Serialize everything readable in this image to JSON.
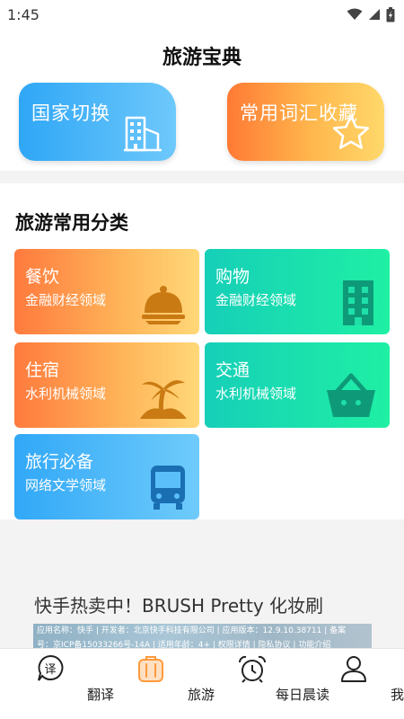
{
  "status_bar": {
    "time": "1:45"
  },
  "header": {
    "title": "旅游宝典",
    "cards": [
      {
        "label": "国家切换",
        "icon": "building-icon"
      },
      {
        "label": "常用词汇收藏",
        "icon": "star-icon"
      }
    ]
  },
  "categories": {
    "title": "旅游常用分类",
    "items": [
      {
        "title": "餐饮",
        "subtitle": "金融财经领域",
        "icon": "food-dome-icon",
        "color": "#ff8a3d"
      },
      {
        "title": "购物",
        "subtitle": "金融财经领域",
        "icon": "office-building-icon",
        "color": "#1ee0a8"
      },
      {
        "title": "住宿",
        "subtitle": "水利机械领域",
        "icon": "palm-island-icon",
        "color": "#ff8a3d"
      },
      {
        "title": "交通",
        "subtitle": "水利机械领域",
        "icon": "basket-icon",
        "color": "#1ee0a8"
      },
      {
        "title": "旅行必备",
        "subtitle": "网络文学领域",
        "icon": "bus-icon",
        "color": "#3aaaf7"
      }
    ]
  },
  "ad": {
    "title": "快手热卖中！BRUSH Pretty 化妆刷",
    "info_line1": "应用名称：快手 | 开发者：北京快手科技有限公司 | 应用版本：12.9.10.38711 | 备案",
    "info_line2": "号：京ICP备15033266号-14A | 适用年龄：4+ | 权限详情 | 隐私协议 | 功能介绍"
  },
  "tabbar": {
    "items": [
      {
        "label": "翻译",
        "icon": "translate-icon",
        "active": false
      },
      {
        "label": "旅游",
        "icon": "luggage-icon",
        "active": true
      },
      {
        "label": "每日晨读",
        "icon": "alarm-clock-icon",
        "active": false
      },
      {
        "label": "我的",
        "icon": "user-icon",
        "active": false
      }
    ]
  },
  "colors": {
    "accent_orange": "#ff8a3d",
    "accent_green": "#1ee0a8",
    "accent_blue": "#3aaaf7",
    "icon_brown": "#c97a12",
    "icon_dark_green": "#0e9a78",
    "icon_dark_blue": "#1a6fb3"
  }
}
